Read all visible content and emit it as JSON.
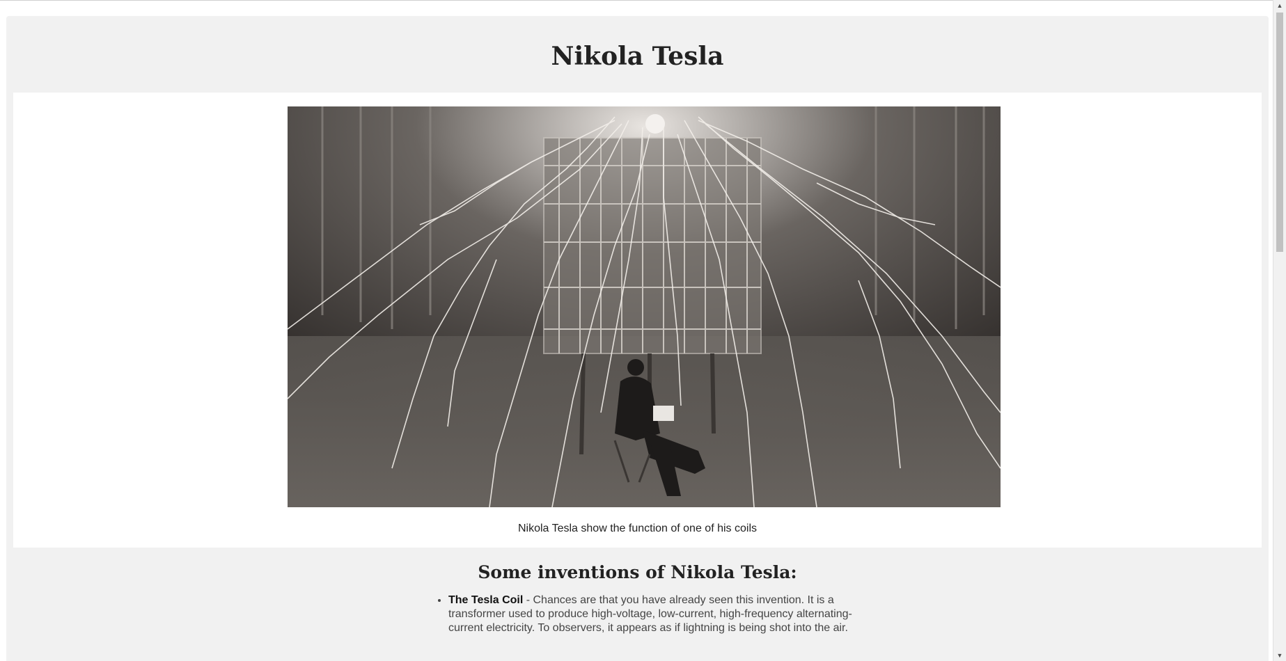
{
  "page": {
    "title": "Nikola Tesla"
  },
  "figure": {
    "caption": "Nikola Tesla show the function of one of his coils"
  },
  "inventions": {
    "heading": "Some inventions of Nikola Tesla:",
    "items": [
      {
        "name": "The Tesla Coil",
        "description": " - Chances are that you have already seen this invention. It is a transformer used to produce high-voltage, low-current, high-frequency alternating-current electricity. To observers, it appears as if lightning is being shot into the air."
      }
    ]
  },
  "scrollbar": {
    "up_icon": "triangle-up-icon",
    "down_icon": "triangle-down-icon",
    "up_glyph": "▲",
    "down_glyph": "▼"
  },
  "colors": {
    "page_background": "#f1f1f1",
    "image_panel": "#ffffff",
    "text": "#222222"
  }
}
